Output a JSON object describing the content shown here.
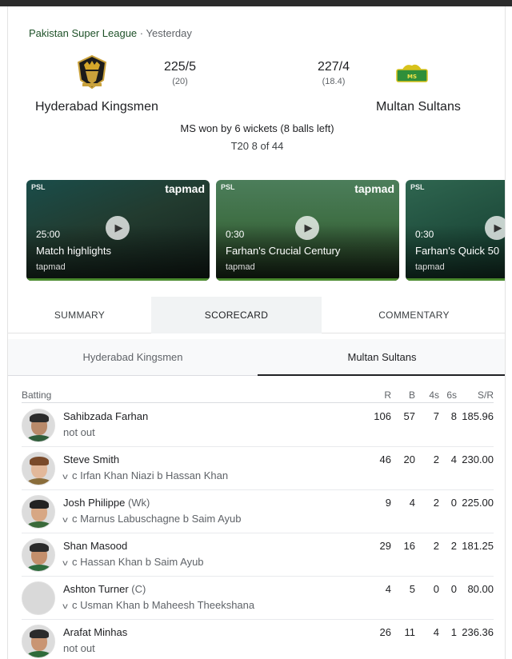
{
  "match": {
    "league": "Pakistan Super League",
    "separator": "·",
    "when": "Yesterday",
    "result": "MS won by 6 wickets (8 balls left)",
    "match_no": "T20 8 of 44"
  },
  "teams": {
    "home": {
      "name": "Hyderabad Kingsmen",
      "score": "225/5",
      "overs": "(20)",
      "logo": "hyderabad-kingsmen-logo"
    },
    "away": {
      "name": "Multan Sultans",
      "score": "227/4",
      "overs": "(18.4)",
      "logo": "multan-sultans-logo"
    }
  },
  "videos": [
    {
      "duration": "25:00",
      "title": "Match highlights",
      "source": "tapmad",
      "brand": "tapmad",
      "badge": "PSL"
    },
    {
      "duration": "0:30",
      "title": "Farhan's Crucial Century",
      "source": "tapmad",
      "brand": "tapmad",
      "badge": "PSL"
    },
    {
      "duration": "0:30",
      "title": "Farhan's Quick 50",
      "source": "tapmad",
      "brand": "tapmad",
      "badge": "PSL"
    }
  ],
  "tabs": {
    "summary": "SUMMARY",
    "scorecard": "SCORECARD",
    "commentary": "COMMENTARY",
    "active": "SCORECARD"
  },
  "team_tabs": {
    "home": "Hyderabad Kingsmen",
    "away": "Multan Sultans",
    "active": "Multan Sultans"
  },
  "batting": {
    "label": "Batting",
    "columns": {
      "r": "R",
      "b": "B",
      "fours": "4s",
      "sixes": "6s",
      "sr": "S/R"
    },
    "rows": [
      {
        "name": "Sahibzada Farhan",
        "role": "",
        "dismissal": "not out",
        "expandable": false,
        "r": "106",
        "b": "57",
        "fours": "7",
        "sixes": "8",
        "sr": "185.96"
      },
      {
        "name": "Steve Smith",
        "role": "",
        "dismissal": "c Irfan Khan Niazi b Hassan Khan",
        "expandable": true,
        "r": "46",
        "b": "20",
        "fours": "2",
        "sixes": "4",
        "sr": "230.00"
      },
      {
        "name": "Josh Philippe",
        "role": "(Wk)",
        "dismissal": "c Marnus Labuschagne b Saim Ayub",
        "expandable": true,
        "r": "9",
        "b": "4",
        "fours": "2",
        "sixes": "0",
        "sr": "225.00"
      },
      {
        "name": "Shan Masood",
        "role": "",
        "dismissal": "c Hassan Khan b Saim Ayub",
        "expandable": true,
        "r": "29",
        "b": "16",
        "fours": "2",
        "sixes": "2",
        "sr": "181.25"
      },
      {
        "name": "Ashton Turner",
        "role": "(C)",
        "dismissal": "c Usman Khan b Maheesh Theekshana",
        "expandable": true,
        "r": "4",
        "b": "5",
        "fours": "0",
        "sixes": "0",
        "sr": "80.00"
      },
      {
        "name": "Arafat Minhas",
        "role": "",
        "dismissal": "not out",
        "expandable": false,
        "r": "26",
        "b": "11",
        "fours": "4",
        "sixes": "1",
        "sr": "236.36"
      }
    ]
  },
  "icons": {
    "play": "play-icon",
    "expand": "chevron-down-icon"
  },
  "colors": {
    "league_text": "#1e5128",
    "active_tab_bg": "#f1f3f4",
    "active_underline": "#202124"
  }
}
